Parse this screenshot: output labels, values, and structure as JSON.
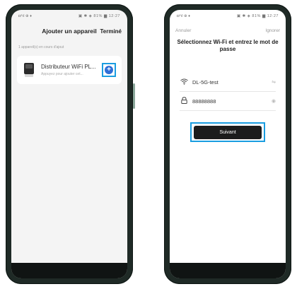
{
  "left_screen": {
    "status_left": "◘⁴ıl ⊕ ♦",
    "status_right": "▣ ✱ ◈ 81% ▆ 12:27",
    "title": "Ajouter un appareil",
    "done_label": "Terminé",
    "section_label": "1 appareil(s) en cours d'ajout",
    "device": {
      "name": "Distributeur WiFi PL...",
      "subtitle": "Appuyez pour ajouter cet...",
      "icon": "feeder-device-icon"
    },
    "add_button": "+"
  },
  "right_screen": {
    "status_left": "◘⁴ıl ⊕ ♦",
    "status_right": "▣ ✱ ◈ 81% ▆ 12:27",
    "cancel_label": "Annuler",
    "skip_label": "Ignorer",
    "prompt": "Sélectionnez Wi-Fi et entrez le mot de passe",
    "wifi": {
      "icon": "wifi-icon",
      "value": "DL-5G-test",
      "action_icon": "switch-network-icon",
      "action_glyph": "⇋"
    },
    "password": {
      "icon": "lock-icon",
      "value": "88888888",
      "action_icon": "eye-icon",
      "action_glyph": "◉"
    },
    "next_label": "Suivant"
  },
  "colors": {
    "highlight": "#1a9de0",
    "add_button": "#2f6fd6",
    "next_button": "#1c1c1c",
    "phone_body": "#1f2a26"
  }
}
